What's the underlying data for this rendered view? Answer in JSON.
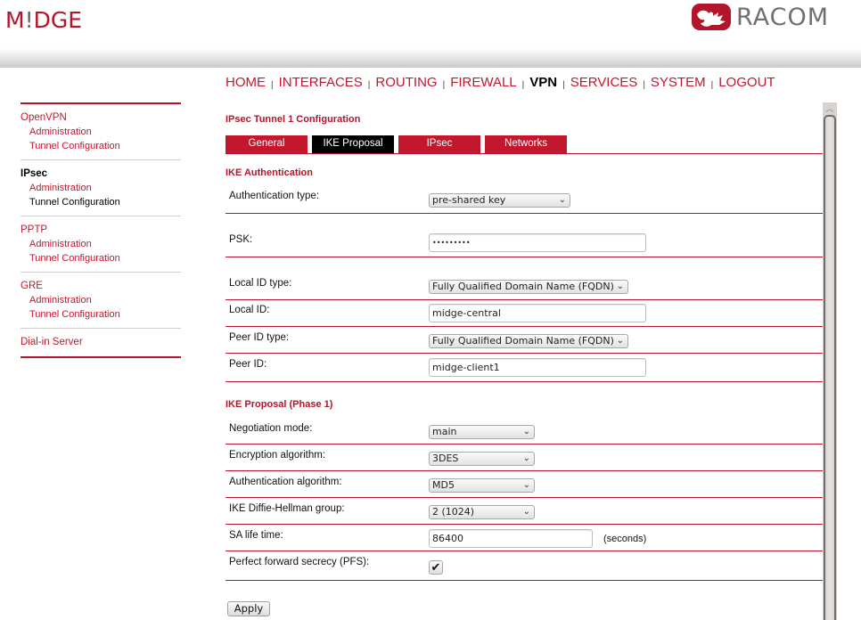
{
  "brand": {
    "left_logo": {
      "pre": "M",
      "bang": "!",
      "post": "DGE"
    },
    "right_logo": "RACOM",
    "accent_color": "#c2172d"
  },
  "topnav": {
    "items": [
      {
        "label": "HOME",
        "active": false
      },
      {
        "label": "INTERFACES",
        "active": false
      },
      {
        "label": "ROUTING",
        "active": false
      },
      {
        "label": "FIREWALL",
        "active": false
      },
      {
        "label": "VPN",
        "active": true
      },
      {
        "label": "SERVICES",
        "active": false
      },
      {
        "label": "SYSTEM",
        "active": false
      },
      {
        "label": "LOGOUT",
        "active": false
      }
    ],
    "separator": "|"
  },
  "sidebar": {
    "groups": [
      {
        "label": "OpenVPN",
        "items": [
          "Administration",
          "Tunnel Configuration"
        ]
      },
      {
        "label": "IPsec",
        "items": [
          "Administration",
          "Tunnel Configuration"
        ]
      },
      {
        "label": "PPTP",
        "items": [
          "Administration",
          "Tunnel Configuration"
        ]
      },
      {
        "label": "GRE",
        "items": [
          "Administration",
          "Tunnel Configuration"
        ]
      },
      {
        "label": "Dial-in Server",
        "items": []
      }
    ]
  },
  "main": {
    "title": "IPsec Tunnel 1 Configuration",
    "tabs": [
      {
        "label": "General",
        "active": false
      },
      {
        "label": "IKE Proposal",
        "active": true
      },
      {
        "label": "IPsec",
        "active": false
      },
      {
        "label": "Networks",
        "active": false
      }
    ],
    "auth_section": {
      "title": "IKE Authentication",
      "auth_type": {
        "label": "Authentication type:",
        "value": "pre-shared key"
      },
      "psk": {
        "label": "PSK:",
        "value": "•••••••••"
      },
      "local_id_type": {
        "label": "Local ID type:",
        "value": "Fully Qualified Domain Name (FQDN)"
      },
      "local_id": {
        "label": "Local ID:",
        "value": "midge-central"
      },
      "peer_id_type": {
        "label": "Peer ID type:",
        "value": "Fully Qualified Domain Name (FQDN)"
      },
      "peer_id": {
        "label": "Peer ID:",
        "value": "midge-client1"
      }
    },
    "proposal_section": {
      "title": "IKE Proposal (Phase 1)",
      "negotiation_mode": {
        "label": "Negotiation mode:",
        "value": "main"
      },
      "encryption": {
        "label": "Encryption algorithm:",
        "value": "3DES"
      },
      "authentication": {
        "label": "Authentication algorithm:",
        "value": "MD5"
      },
      "dh_group": {
        "label": "IKE Diffie-Hellman group:",
        "value": "2 (1024)"
      },
      "sa_lifetime": {
        "label": "SA life time:",
        "value": "86400",
        "unit": "(seconds)"
      },
      "pfs": {
        "label": "Perfect forward secrecy (PFS):",
        "checked": true,
        "glyph": "✔"
      }
    },
    "apply_label": "Apply"
  },
  "icons": {
    "chevron": "⌄",
    "scroll_up": "︿"
  }
}
